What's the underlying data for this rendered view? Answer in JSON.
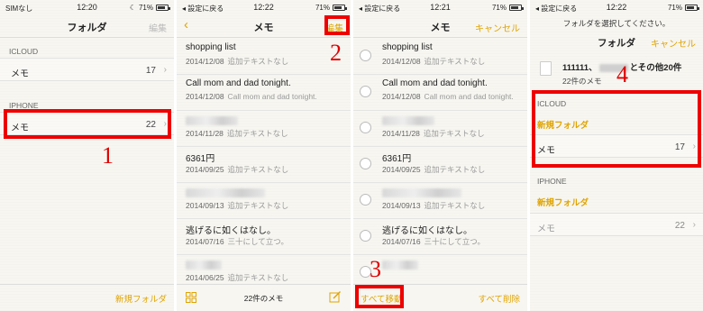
{
  "panel1": {
    "status": {
      "carrier": "SIMなし",
      "time": "12:20",
      "battery": "71%"
    },
    "title": "フォルダ",
    "edit": "編集",
    "icloud_header": "ICLOUD",
    "icloud_row": {
      "label": "メモ",
      "count": "17"
    },
    "iphone_header": "IPHONE",
    "iphone_row": {
      "label": "メモ",
      "count": "22"
    },
    "new_folder": "新規フォルダ",
    "callout": "1"
  },
  "panel2": {
    "status": {
      "back": "設定に戻る",
      "time": "12:22",
      "battery": "71%"
    },
    "title": "メモ",
    "edit": "編集",
    "callout": "2",
    "notes": [
      {
        "title": "shopping list",
        "date": "2014/12/08",
        "sub": "追加テキストなし"
      },
      {
        "title": "Call mom and dad tonight.",
        "date": "2014/12/08",
        "sub": "Call mom and dad tonight."
      },
      {
        "title": "",
        "date": "2014/11/28",
        "sub": "追加テキストなし"
      },
      {
        "title": "6361円",
        "date": "2014/09/25",
        "sub": "追加テキストなし"
      },
      {
        "title": "",
        "date": "2014/09/13",
        "sub": "追加テキストなし"
      },
      {
        "title": "逃げるに如くはなし。",
        "date": "2014/07/16",
        "sub": "三十にして立つ。"
      },
      {
        "title": "",
        "date": "2014/06/25",
        "sub": "追加テキストなし"
      }
    ],
    "footer": "22件のメモ"
  },
  "panel3": {
    "status": {
      "back": "設定に戻る",
      "time": "12:21",
      "battery": "71%"
    },
    "title": "メモ",
    "cancel": "キャンセル",
    "move_all": "すべて移動",
    "delete_all": "すべて削除",
    "callout": "3"
  },
  "panel4": {
    "status": {
      "back": "設定に戻る",
      "time": "12:22",
      "battery": "71%"
    },
    "prompt": "フォルダを選択してください。",
    "title": "フォルダ",
    "cancel": "キャンセル",
    "selection": {
      "prefix": "111111、",
      "suffix": "とその他20件",
      "count": "22件のメモ"
    },
    "icloud_header": "ICLOUD",
    "icloud_new_folder": "新規フォルダ",
    "icloud_row": {
      "label": "メモ",
      "count": "17"
    },
    "iphone_header": "IPHONE",
    "iphone_new_folder": "新規フォルダ",
    "iphone_row": {
      "label": "メモ",
      "count": "22"
    },
    "callout": "4"
  },
  "colors": {
    "accent": "#e0a400",
    "callout": "#ee0000"
  }
}
